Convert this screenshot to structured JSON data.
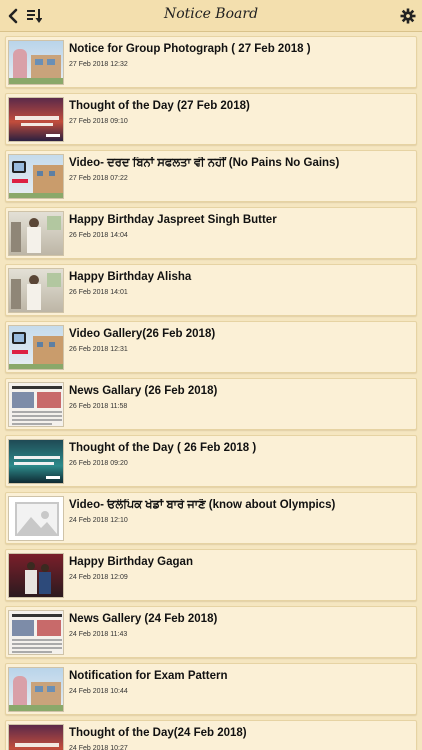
{
  "header": {
    "title": "Notice Board",
    "back_icon": "chevron-left-icon",
    "sort_icon": "sort-list-icon",
    "settings_icon": "gear-icon"
  },
  "colors": {
    "background": "#f5e6c0",
    "header": "#f3dfae",
    "card": "#fbf0d6"
  },
  "notices": [
    {
      "title": "Notice for Group Photograph ( 27 Feb 2018 )",
      "date": "27 Feb 2018 12:32",
      "thumb": "photo-notice"
    },
    {
      "title": "Thought of the Day (27 Feb 2018)",
      "date": "27 Feb 2018 09:10",
      "thumb": "thought-sunset"
    },
    {
      "title": "Video- ਦਰਦ ਬਿਨਾਂ ਸਫਲਤਾ ਵੀ ਨਹੀਂ (No Pains No Gains)",
      "date": "27 Feb 2018 07:22",
      "thumb": "video-building"
    },
    {
      "title": "Happy Birthday Jaspreet Singh Butter",
      "date": "26 Feb 2018 14:04",
      "thumb": "birthday-room"
    },
    {
      "title": "Happy Birthday Alisha",
      "date": "26 Feb 2018 14:01",
      "thumb": "birthday-room"
    },
    {
      "title": "Video Gallery(26 Feb 2018)",
      "date": "26 Feb 2018 12:31",
      "thumb": "video-building"
    },
    {
      "title": "News Gallary (26 Feb 2018)",
      "date": "26 Feb 2018 11:58",
      "thumb": "newspaper"
    },
    {
      "title": "Thought of the Day ( 26 Feb 2018 )",
      "date": "26 Feb 2018 09:20",
      "thumb": "thought-teal"
    },
    {
      "title": "Video- ਓਲੰਪਿਕ ਖੇਡਾਂ ਬਾਰੇ ਜਾਣੋ (know about Olympics)",
      "date": "24 Feb 2018 12:10",
      "thumb": "placeholder"
    },
    {
      "title": "Happy Birthday Gagan",
      "date": "24 Feb 2018 12:09",
      "thumb": "birthday-stage"
    },
    {
      "title": "News Gallery (24 Feb 2018)",
      "date": "24 Feb 2018 11:43",
      "thumb": "newspaper"
    },
    {
      "title": "Notification for Exam Pattern",
      "date": "24 Feb 2018 10:44",
      "thumb": "photo-notice"
    },
    {
      "title": "Thought of the Day(24 Feb 2018)",
      "date": "24 Feb 2018 10:27",
      "thumb": "thought-sunset"
    }
  ]
}
